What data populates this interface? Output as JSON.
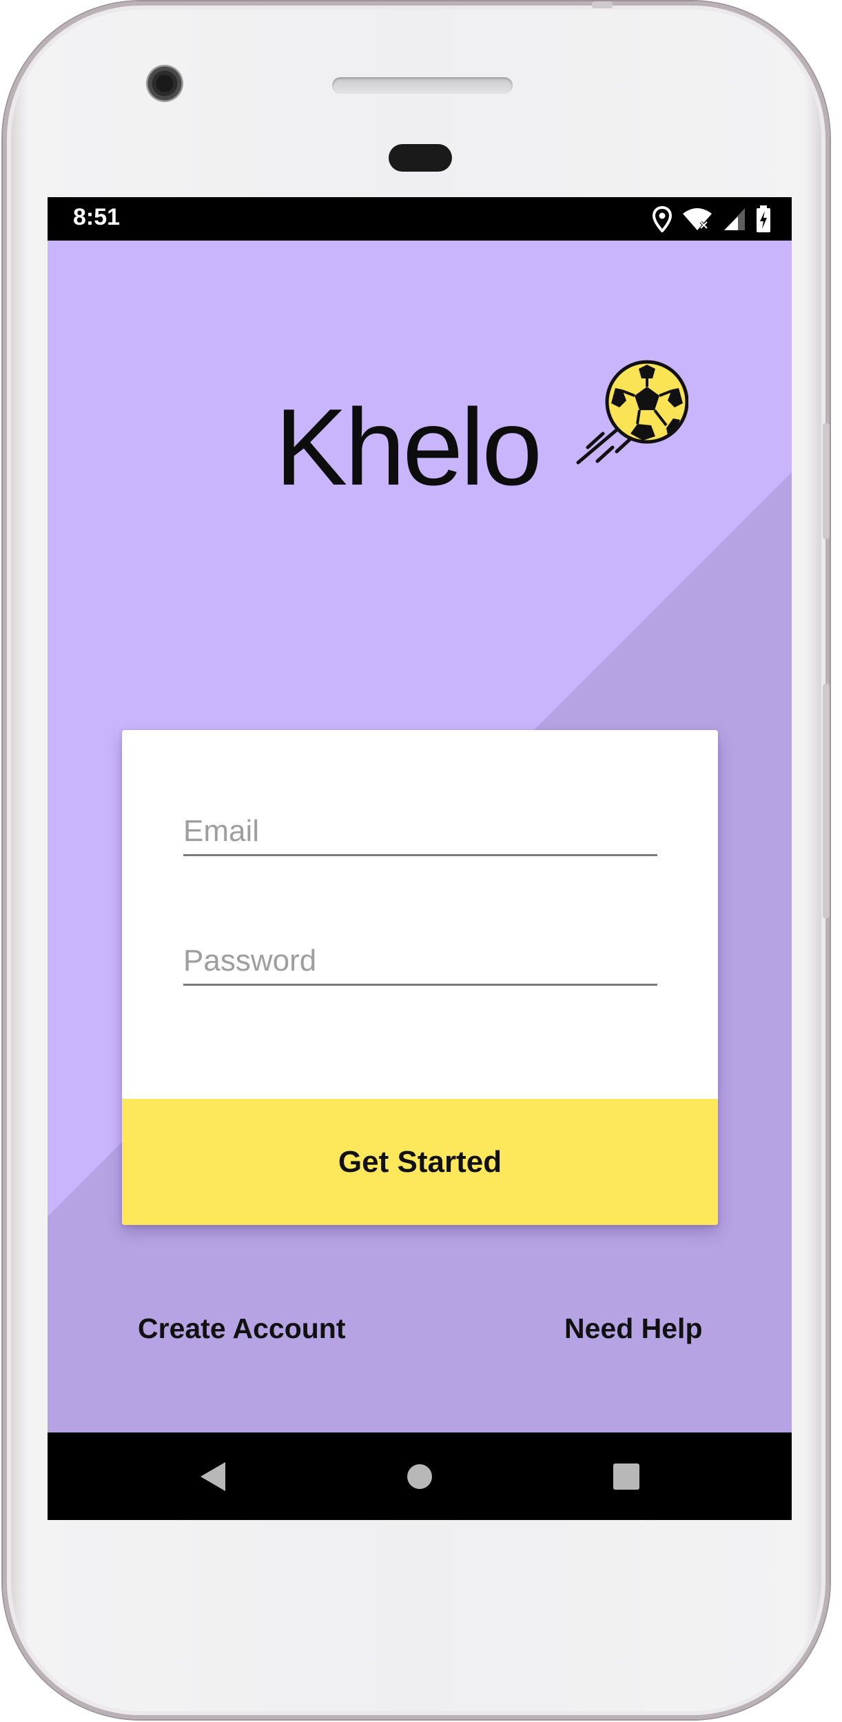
{
  "status_bar": {
    "time": "8:51",
    "icons": [
      "location-icon",
      "wifi-icon",
      "signal-icon",
      "battery-charging-icon"
    ]
  },
  "app": {
    "title": "Khelo",
    "logo_icon": "soccer-ball-icon",
    "colors": {
      "background_light": "#c9b5fb",
      "background_dark": "#b5a3e3",
      "button": "#fde75b",
      "ball_fill": "#fbe356"
    }
  },
  "login_form": {
    "email_placeholder": "Email",
    "password_placeholder": "Password",
    "submit_label": "Get Started"
  },
  "footer_links": {
    "create_account": "Create Account",
    "need_help": "Need Help"
  },
  "nav_bar": {
    "buttons": [
      "back-icon",
      "home-icon",
      "recents-icon"
    ]
  }
}
